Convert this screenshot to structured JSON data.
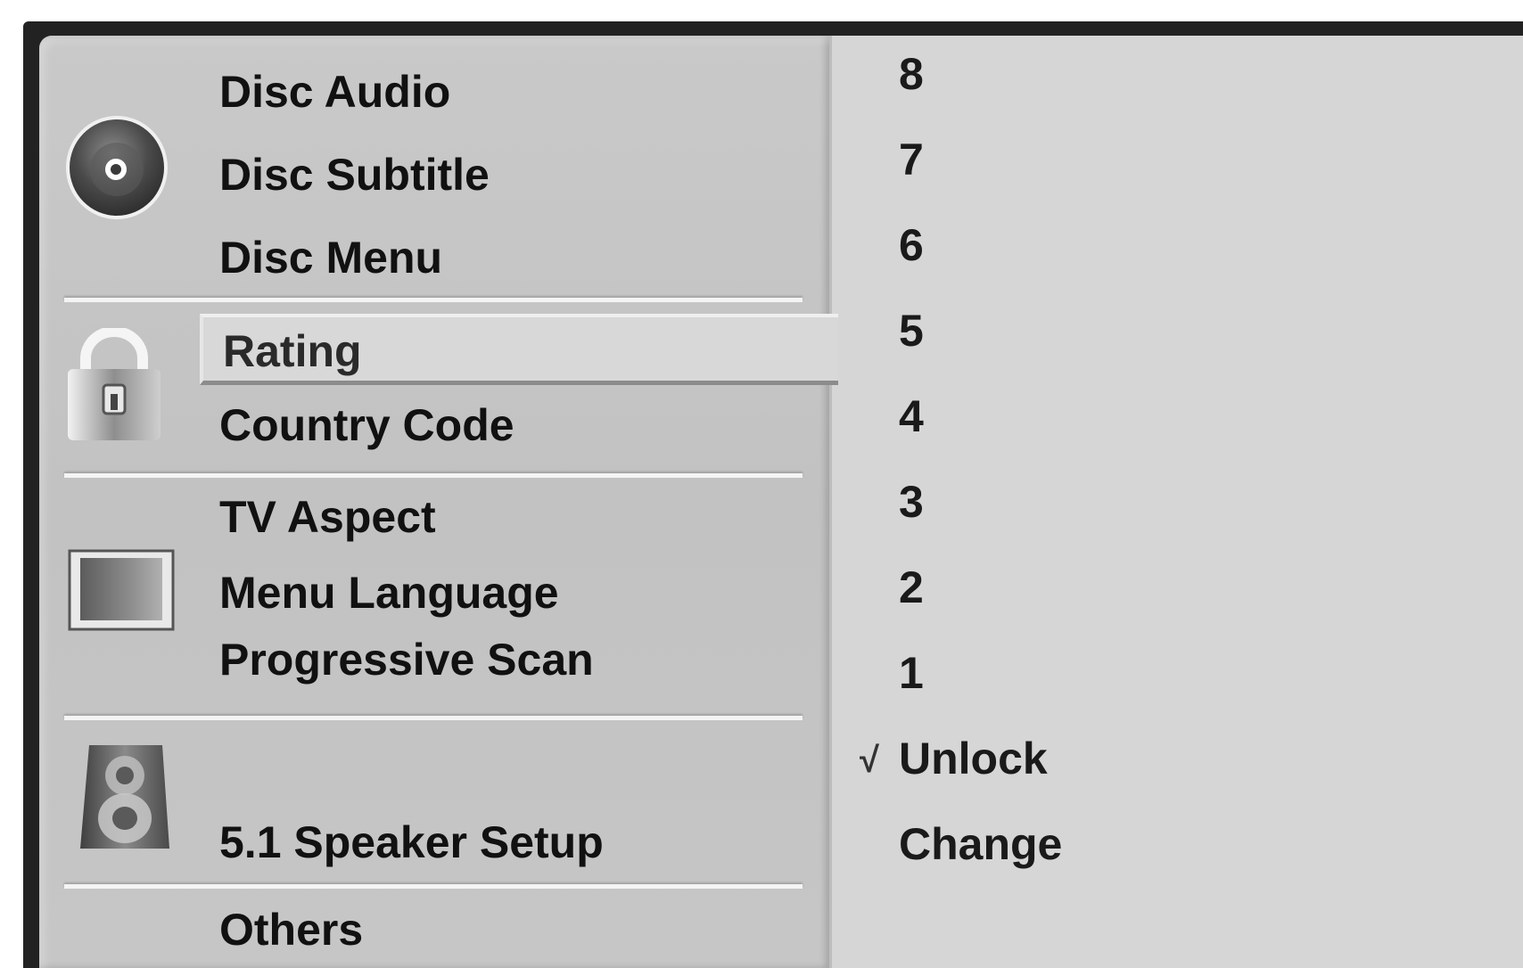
{
  "menu": {
    "disc": {
      "icon": "disc-icon",
      "items": [
        "Disc Audio",
        "Disc Subtitle",
        "Disc Menu"
      ]
    },
    "lock": {
      "icon": "padlock-icon",
      "items": [
        "Rating",
        "Country Code"
      ],
      "selected_index": 0
    },
    "display": {
      "icon": "tv-screen-icon",
      "items": [
        "TV Aspect",
        "Menu Language",
        "Progressive Scan"
      ]
    },
    "audio": {
      "icon": "speaker-icon",
      "items": [
        "5.1 Speaker Setup"
      ]
    },
    "others": {
      "items": [
        "Others"
      ]
    }
  },
  "rating_options": {
    "items": [
      "8",
      "7",
      "6",
      "5",
      "4",
      "3",
      "2",
      "1",
      "Unlock",
      "Change"
    ],
    "checked_index": 8,
    "check_glyph": "√"
  },
  "colors": {
    "panel": "#c6c6c6",
    "submenu": "#d6d6d6",
    "frame": "#222222",
    "highlight": "#d8d8d8",
    "text": "#111111"
  }
}
